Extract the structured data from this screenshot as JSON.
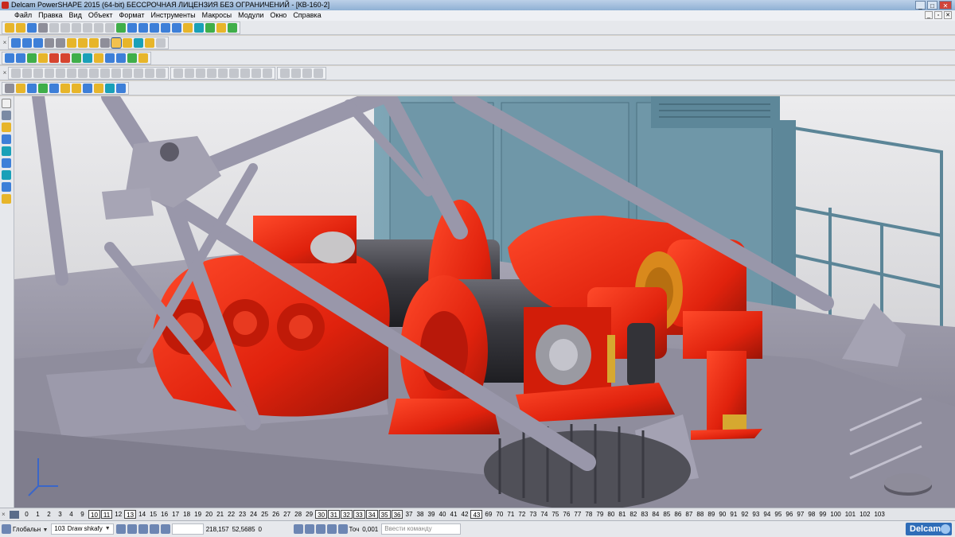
{
  "window": {
    "title": "Delcam PowerSHAPE 2015 (64-bit) БЕССРОЧНАЯ ЛИЦЕНЗИЯ БЕЗ ОГРАНИЧЕНИЙ - [КВ-160-2]"
  },
  "menu": [
    "Файл",
    "Правка",
    "Вид",
    "Объект",
    "Формат",
    "Инструменты",
    "Макросы",
    "Модули",
    "Окно",
    "Справка"
  ],
  "layers": [
    "0",
    "1",
    "2",
    "3",
    "4",
    "9",
    "10",
    "11",
    "12",
    "13",
    "14",
    "15",
    "16",
    "17",
    "18",
    "19",
    "20",
    "21",
    "22",
    "23",
    "24",
    "25",
    "26",
    "27",
    "28",
    "29",
    "30",
    "31",
    "32",
    "33",
    "34",
    "35",
    "36",
    "37",
    "38",
    "39",
    "40",
    "41",
    "42",
    "43",
    "69",
    "70",
    "71",
    "72",
    "73",
    "74",
    "75",
    "76",
    "77",
    "78",
    "79",
    "80",
    "81",
    "82",
    "83",
    "84",
    "85",
    "86",
    "87",
    "88",
    "89",
    "90",
    "91",
    "92",
    "93",
    "94",
    "95",
    "96",
    "97",
    "98",
    "99",
    "100",
    "101",
    "102",
    "103"
  ],
  "active_layers": [
    "10",
    "11",
    "13",
    "30",
    "31",
    "32",
    "33",
    "34",
    "35",
    "36",
    "43"
  ],
  "status": {
    "workplane": "Глобальн",
    "level_number": "103",
    "level_name": "Draw shkafy",
    "x": "218,157",
    "y": "52,5685",
    "z": "0",
    "tolerance_label": "Точ",
    "tolerance_value": "0,001",
    "command_placeholder": "Ввести команду"
  },
  "brand": "Delcam",
  "colors": {
    "accent": "#2f6db8",
    "machinery": "#e0220d",
    "frame": "#9a98a8"
  }
}
